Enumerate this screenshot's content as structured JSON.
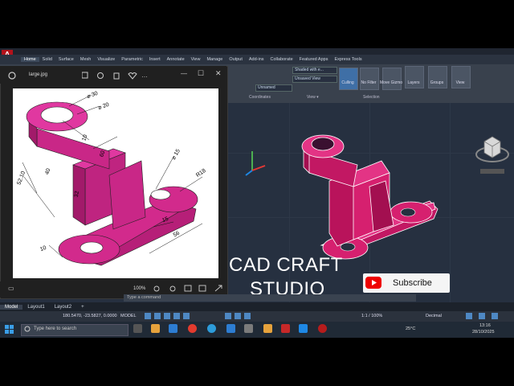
{
  "ribbon": {
    "tabs": [
      "Home",
      "Solid",
      "Surface",
      "Mesh",
      "Visualize",
      "Parametric",
      "Insert",
      "Annotate",
      "View",
      "Manage",
      "Output",
      "Add-ins",
      "Collaborate",
      "Featured Apps",
      "Express Tools"
    ],
    "active_tab": "Home",
    "dropdowns": [
      "Shaded with e...",
      "Unsaved View",
      "Unnamed"
    ],
    "buttons": [
      {
        "label": "Culling"
      },
      {
        "label": "No Filter"
      },
      {
        "label": "Move Gizmo"
      },
      {
        "label": "Layers"
      },
      {
        "label": "Groups"
      },
      {
        "label": "View"
      }
    ],
    "groups": [
      "Coordinates",
      "View ▾",
      "Selection"
    ]
  },
  "viewer": {
    "filename": "large.jpg",
    "zoom": "100%",
    "dimensions": [
      "⌀ 30",
      "⌀ 20",
      "10",
      "40",
      "60",
      "32",
      "⌀ 15",
      "R18",
      "15",
      "56",
      "10",
      "52.10"
    ]
  },
  "watermark": {
    "line1": "CAD CRAFT",
    "line2": "STUDIO",
    "subscribe": "Subscribe"
  },
  "layout_tabs": [
    "Model",
    "Layout1",
    "Layout2",
    "+"
  ],
  "command": {
    "placeholder": "Type a command"
  },
  "status": {
    "coords": "180.5470, -23.5827, 0.0000",
    "model": "MODEL",
    "scale": "1:1 / 100%",
    "units": "Decimal"
  },
  "taskbar": {
    "search": "Type here to search",
    "temp": "25°C",
    "time": "13:16",
    "date": "28/10/2025"
  },
  "colors": {
    "model": "#d6206f",
    "canvas": "#263040",
    "ribbon": "#39414d"
  }
}
